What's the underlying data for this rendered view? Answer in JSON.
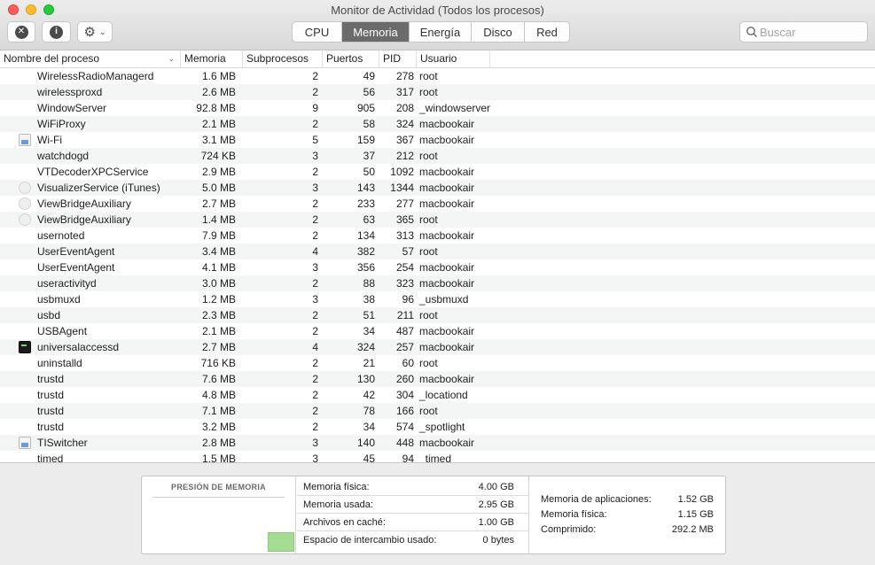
{
  "window": {
    "title": "Monitor de Actividad (Todos los procesos)"
  },
  "toolbar": {
    "close_process_icon": "x-circle-icon",
    "info_icon": "info-circle-icon",
    "gear_icon": "gear-icon",
    "tabs": [
      {
        "label": "CPU",
        "active": false
      },
      {
        "label": "Memoria",
        "active": true
      },
      {
        "label": "Energía",
        "active": false
      },
      {
        "label": "Disco",
        "active": false
      },
      {
        "label": "Red",
        "active": false
      }
    ],
    "search_placeholder": "Buscar"
  },
  "table": {
    "columns": {
      "name": "Nombre del proceso",
      "memory": "Memoria",
      "threads": "Subprocesos",
      "ports": "Puertos",
      "pid": "PID",
      "user": "Usuario"
    },
    "rows": [
      {
        "name": "WirelessRadioManagerd",
        "memory": "1.6 MB",
        "threads": "2",
        "ports": "49",
        "pid": "278",
        "user": "root",
        "icon": ""
      },
      {
        "name": "wirelessproxd",
        "memory": "2.6 MB",
        "threads": "2",
        "ports": "56",
        "pid": "317",
        "user": "root",
        "icon": ""
      },
      {
        "name": "WindowServer",
        "memory": "92.8 MB",
        "threads": "9",
        "ports": "905",
        "pid": "208",
        "user": "_windowserver",
        "icon": ""
      },
      {
        "name": "WiFiProxy",
        "memory": "2.1 MB",
        "threads": "2",
        "ports": "58",
        "pid": "324",
        "user": "macbookair",
        "icon": ""
      },
      {
        "name": "Wi-Fi",
        "memory": "3.1 MB",
        "threads": "5",
        "ports": "159",
        "pid": "367",
        "user": "macbookair",
        "icon": "doc"
      },
      {
        "name": "watchdogd",
        "memory": "724 KB",
        "threads": "3",
        "ports": "37",
        "pid": "212",
        "user": "root",
        "icon": ""
      },
      {
        "name": "VTDecoderXPCService",
        "memory": "2.9 MB",
        "threads": "2",
        "ports": "50",
        "pid": "1092",
        "user": "macbookair",
        "icon": ""
      },
      {
        "name": "VisualizerService (iTunes)",
        "memory": "5.0 MB",
        "threads": "3",
        "ports": "143",
        "pid": "1344",
        "user": "macbookair",
        "icon": "round"
      },
      {
        "name": "ViewBridgeAuxiliary",
        "memory": "2.7 MB",
        "threads": "2",
        "ports": "233",
        "pid": "277",
        "user": "macbookair",
        "icon": "round"
      },
      {
        "name": "ViewBridgeAuxiliary",
        "memory": "1.4 MB",
        "threads": "2",
        "ports": "63",
        "pid": "365",
        "user": "root",
        "icon": "round"
      },
      {
        "name": "usernoted",
        "memory": "7.9 MB",
        "threads": "2",
        "ports": "134",
        "pid": "313",
        "user": "macbookair",
        "icon": ""
      },
      {
        "name": "UserEventAgent",
        "memory": "3.4 MB",
        "threads": "4",
        "ports": "382",
        "pid": "57",
        "user": "root",
        "icon": ""
      },
      {
        "name": "UserEventAgent",
        "memory": "4.1 MB",
        "threads": "3",
        "ports": "356",
        "pid": "254",
        "user": "macbookair",
        "icon": ""
      },
      {
        "name": "useractivityd",
        "memory": "3.0 MB",
        "threads": "2",
        "ports": "88",
        "pid": "323",
        "user": "macbookair",
        "icon": ""
      },
      {
        "name": "usbmuxd",
        "memory": "1.2 MB",
        "threads": "3",
        "ports": "38",
        "pid": "96",
        "user": "_usbmuxd",
        "icon": ""
      },
      {
        "name": "usbd",
        "memory": "2.3 MB",
        "threads": "2",
        "ports": "51",
        "pid": "211",
        "user": "root",
        "icon": ""
      },
      {
        "name": "USBAgent",
        "memory": "2.1 MB",
        "threads": "2",
        "ports": "34",
        "pid": "487",
        "user": "macbookair",
        "icon": ""
      },
      {
        "name": "universalaccessd",
        "memory": "2.7 MB",
        "threads": "4",
        "ports": "324",
        "pid": "257",
        "user": "macbookair",
        "icon": "term"
      },
      {
        "name": "uninstalld",
        "memory": "716 KB",
        "threads": "2",
        "ports": "21",
        "pid": "60",
        "user": "root",
        "icon": ""
      },
      {
        "name": "trustd",
        "memory": "7.6 MB",
        "threads": "2",
        "ports": "130",
        "pid": "260",
        "user": "macbookair",
        "icon": ""
      },
      {
        "name": "trustd",
        "memory": "4.8 MB",
        "threads": "2",
        "ports": "42",
        "pid": "304",
        "user": "_locationd",
        "icon": ""
      },
      {
        "name": "trustd",
        "memory": "7.1 MB",
        "threads": "2",
        "ports": "78",
        "pid": "166",
        "user": "root",
        "icon": ""
      },
      {
        "name": "trustd",
        "memory": "3.2 MB",
        "threads": "2",
        "ports": "34",
        "pid": "574",
        "user": "_spotlight",
        "icon": ""
      },
      {
        "name": "TISwitcher",
        "memory": "2.8 MB",
        "threads": "3",
        "ports": "140",
        "pid": "448",
        "user": "macbookair",
        "icon": "doc"
      },
      {
        "name": "timed",
        "memory": "1.5 MB",
        "threads": "3",
        "ports": "45",
        "pid": "94",
        "user": "_timed",
        "icon": ""
      }
    ]
  },
  "memory_pressure": {
    "title": "PRESIÓN DE MEMORIA",
    "color": "#a4dd92"
  },
  "memory_stats": [
    {
      "label": "Memoria física:",
      "value": "4.00 GB"
    },
    {
      "label": "Memoria usada:",
      "value": "2.95 GB"
    },
    {
      "label": "Archivos en caché:",
      "value": "1.00 GB"
    },
    {
      "label": "Espacio de intercambio usado:",
      "value": "0 bytes"
    }
  ],
  "memory_breakdown": [
    {
      "label": "Memoria de aplicaciones:",
      "value": "1.52 GB"
    },
    {
      "label": "Memoria física:",
      "value": "1.15 GB"
    },
    {
      "label": "Comprimido:",
      "value": "292.2 MB"
    }
  ]
}
